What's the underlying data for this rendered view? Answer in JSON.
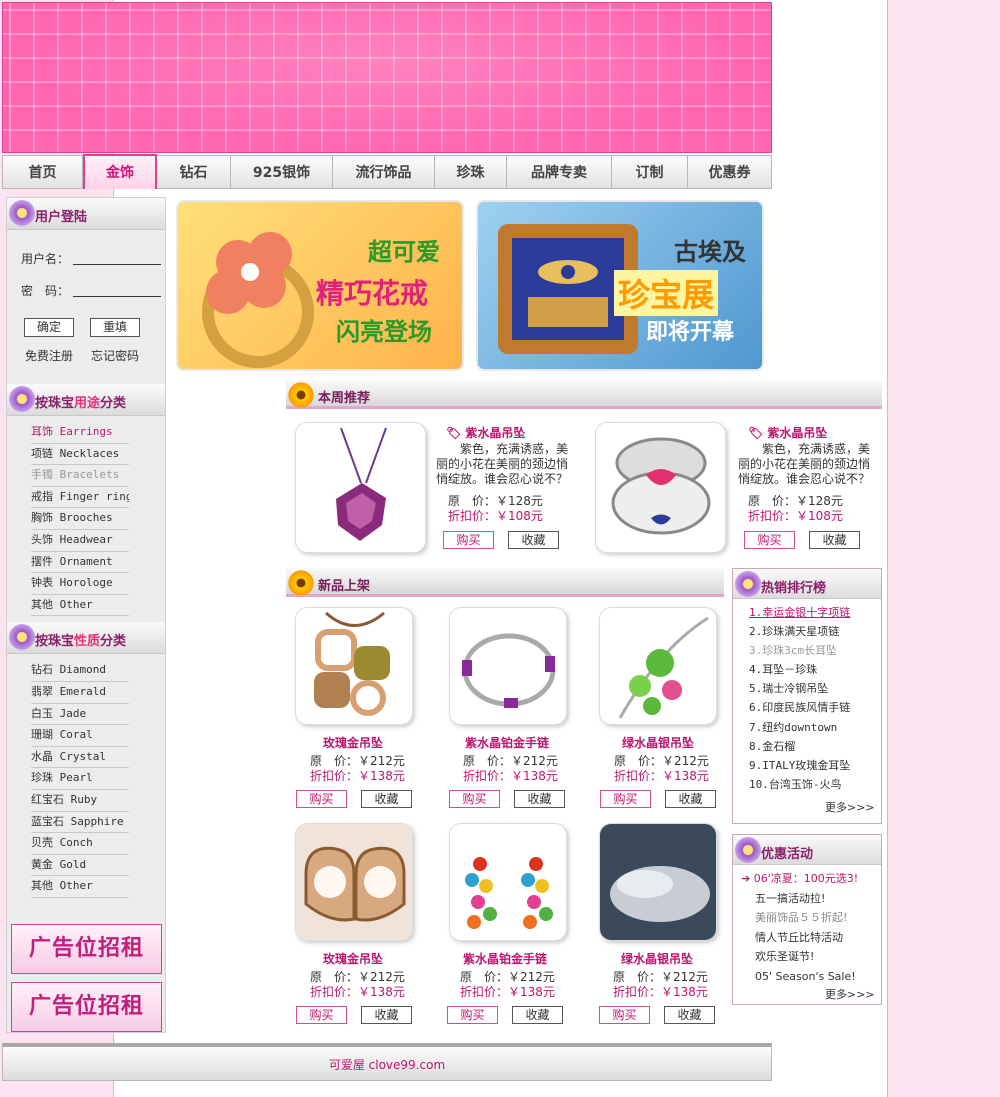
{
  "nav": [
    "首页",
    "金饰",
    "钻石",
    "925银饰",
    "流行饰品",
    "珍珠",
    "品牌专卖",
    "订制",
    "优惠券"
  ],
  "login": {
    "title": "用户登陆",
    "username_label": "用户名：",
    "password_label": "密　码：",
    "confirm": "确定",
    "reset": "重填",
    "register": "免费注册",
    "forgot": "忘记密码"
  },
  "usage": {
    "title_a": "按珠宝",
    "title_b": "用途",
    "title_c": "分类",
    "items": [
      "耳饰 Earrings",
      "项链 Necklaces",
      "手镯 Bracelets",
      "戒指 Finger ring",
      "胸饰 Brooches",
      "头饰 Headwear",
      "摆件 Ornament",
      "钟表 Horologe",
      "其他 Other"
    ]
  },
  "material": {
    "title_a": "按珠宝",
    "title_b": "性质",
    "title_c": "分类",
    "items": [
      "钻石 Diamond",
      "翡翠 Emerald",
      "白玉 Jade",
      "珊瑚 Coral",
      "水晶 Crystal",
      "珍珠 Pearl",
      "红宝石 Ruby",
      "蓝宝石 Sapphire",
      "贝壳 Conch",
      "黄金 Gold",
      "其他 Other"
    ]
  },
  "ads": [
    "广告位招租",
    "广告位招租"
  ],
  "promo1": {
    "l1": "超可爱",
    "l2": "精巧花戒",
    "l3": "闪亮登场"
  },
  "promo2": {
    "l1": "古埃及",
    "l2": "珍宝展",
    "l3": "即将开幕"
  },
  "weekly": {
    "title": "本周推荐",
    "items": [
      {
        "name": "紫水晶吊坠",
        "desc": "紫色，充满诱惑，美丽的小花在美丽的颈边悄悄绽放。谁会忍心说不？",
        "orig": "原　价：￥128元",
        "sale": "折扣价：￥108元"
      },
      {
        "name": "紫水晶吊坠",
        "desc": "紫色，充满诱惑，美丽的小花在美丽的颈边悄悄绽放。谁会忍心说不？",
        "orig": "原　价：￥128元",
        "sale": "折扣价：￥108元"
      }
    ]
  },
  "new": {
    "title": "新品上架",
    "items": [
      {
        "name": "玫瑰金吊坠",
        "orig": "原　价：￥212元",
        "sale": "折扣价：￥138元"
      },
      {
        "name": "紫水晶铂金手链",
        "orig": "原　价：￥212元",
        "sale": "折扣价：￥138元"
      },
      {
        "name": "绿水晶银吊坠",
        "orig": "原　价：￥212元",
        "sale": "折扣价：￥138元"
      },
      {
        "name": "玫瑰金吊坠",
        "orig": "原　价：￥212元",
        "sale": "折扣价：￥138元"
      },
      {
        "name": "紫水晶铂金手链",
        "orig": "原　价：￥212元",
        "sale": "折扣价：￥138元"
      },
      {
        "name": "绿水晶银吊坠",
        "orig": "原　价：￥212元",
        "sale": "折扣价：￥138元"
      }
    ]
  },
  "buy": "购买",
  "fav": "收藏",
  "hot": {
    "title": "热销排行榜",
    "items": [
      "1.幸运金银十字项链",
      "2.珍珠满天星项链",
      "3.珍珠3cm长耳坠",
      "4.耳坠－珍珠",
      "5.瑞士冷钢吊坠",
      "6.印度民族风情手链",
      "7.纽约downtown",
      "8.金石榴",
      "9.ITALY玫瑰金耳坠",
      "10.台湾玉饰-火鸟"
    ],
    "more": "更多>>>"
  },
  "deals": {
    "title": "优惠活动",
    "items": [
      "06'凉夏：100元选3!",
      "五一搞活动拉!",
      "美丽饰品５５折起!",
      "情人节丘比特活动",
      "欢乐圣诞节!",
      "05' Season's Sale!"
    ],
    "more": "更多>>>"
  },
  "footer": "可爱屋 clove99.com"
}
